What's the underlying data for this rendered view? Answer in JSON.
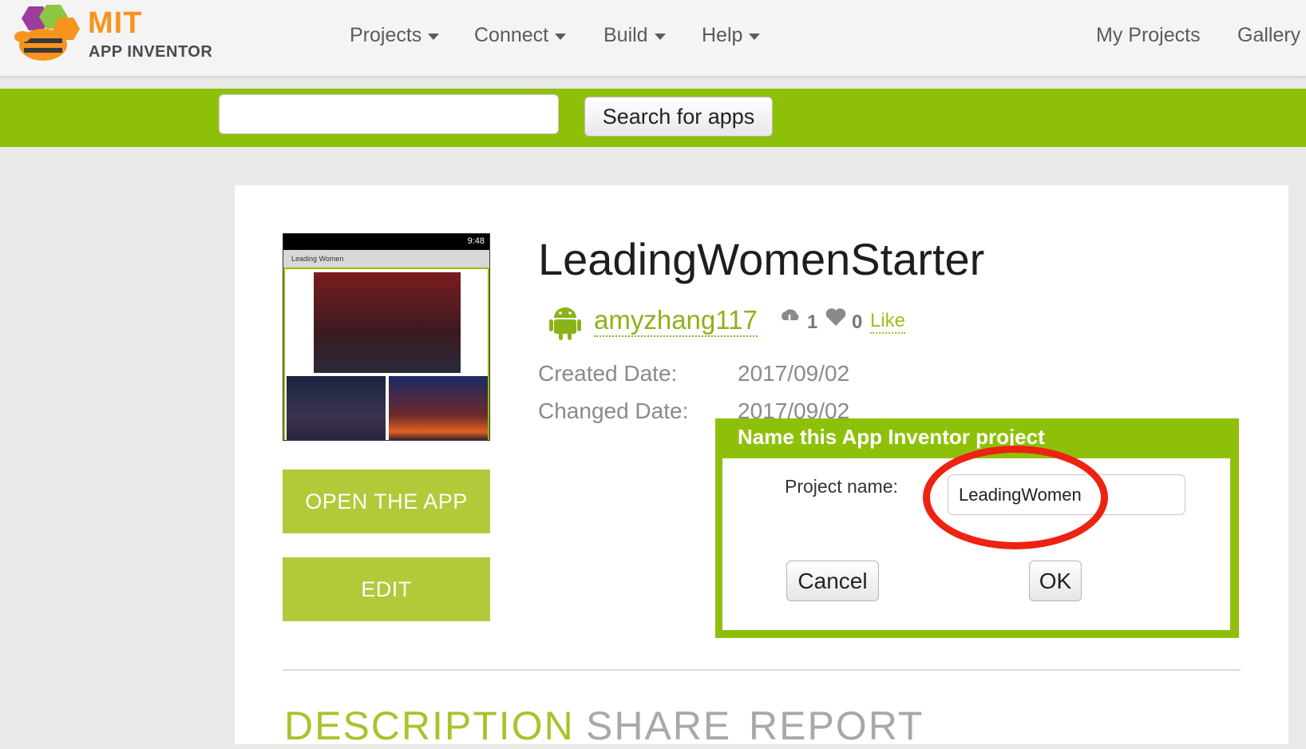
{
  "brand": {
    "line1": "MIT",
    "line2": "APP INVENTOR"
  },
  "nav": {
    "menus": [
      "Projects",
      "Connect",
      "Build",
      "Help"
    ],
    "links": [
      "My Projects",
      "Gallery"
    ]
  },
  "search": {
    "value": "",
    "button_label": "Search for apps"
  },
  "app": {
    "title": "LeadingWomenStarter",
    "author": "amyzhang117",
    "downloads": "1",
    "likes": "0",
    "like_label": "Like",
    "created_label": "Created Date:",
    "created_value": "2017/09/02",
    "changed_label": "Changed Date:",
    "changed_value": "2017/09/02",
    "screenshot": {
      "status_time": "9:48",
      "screen_title": "Leading Women"
    }
  },
  "actions": {
    "open_label": "OPEN THE APP",
    "edit_label": "EDIT"
  },
  "tabs": [
    "DESCRIPTION",
    "SHARE",
    "REPORT"
  ],
  "dialog": {
    "title": "Name this App Inventor project",
    "field_label": "Project name:",
    "field_value": "LeadingWomen",
    "cancel_label": "Cancel",
    "ok_label": "OK"
  },
  "colors": {
    "accent_green": "#8ec00a",
    "button_green": "#b2c93a",
    "annotation_red": "#ee2211",
    "logo_orange": "#f7941d"
  }
}
